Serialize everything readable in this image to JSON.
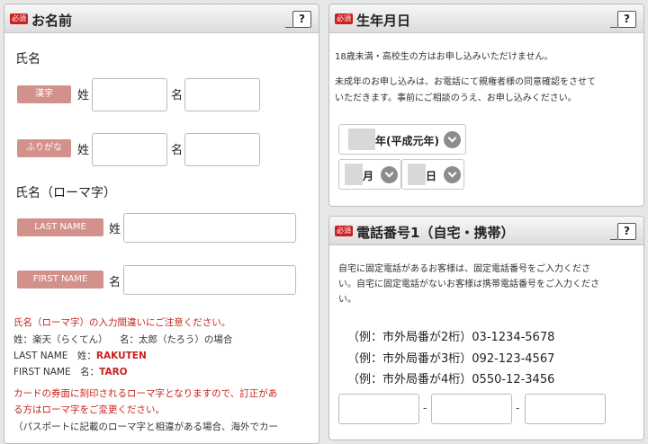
{
  "left_panel": {
    "required_badge": "必須",
    "title": "お名前",
    "help_label": "?",
    "name_heading": "氏名",
    "kanji_tag": "漢字",
    "furigana_tag": "ふりがな",
    "last_label": "姓",
    "first_label": "名",
    "romaji_heading": "氏名（ローマ字）",
    "last_name_tag": "LAST NAME",
    "first_name_tag": "FIRST NAME",
    "caution": "氏名（ローマ字）の入力間違いにご注意ください。",
    "example_line1_a": "姓：楽天（らくてん）",
    "example_line1_b": "名：太郎（たろう）の場合",
    "example_line2_label": "LAST NAME　姓：",
    "example_line2_value": "RAKUTEN",
    "example_line3_label": "FIRST NAME　名：",
    "example_line3_value": "TARO",
    "card_note_1": "カードの券面に刻印されるローマ字となりますので、訂正があ",
    "card_note_2": "る方はローマ字をご変更ください。",
    "passport_note": "（パスポートに記載のローマ字と相違がある場合、海外でカー"
  },
  "birth_panel": {
    "required_badge": "必須",
    "title": "生年月日",
    "help_label": "?",
    "notice_1": "18歳未満・高校生の方はお申し込みいただけません。",
    "notice_2a": "未成年のお申し込みは、お電話にて親権者様の同意確認をさせて",
    "notice_2b": "いただきます。事前にご相談のうえ、お申し込みください。",
    "year_label": "年(平成元年)",
    "month_label": "月",
    "day_label": "日"
  },
  "phone_panel": {
    "required_badge": "必須",
    "title": "電話番号1（自宅・携帯）",
    "help_label": "?",
    "desc_1": "自宅に固定電話があるお客様は、固定電話番号をご入力くださ",
    "desc_2": "い。自宅に固定電話がないお客様は携帯電話番号をご入力くださ",
    "desc_3": "い。",
    "examples": [
      "（例：市外局番が2桁）03-1234-5678",
      "（例：市外局番が3桁）092-123-4567",
      "（例：市外局番が4桁）0550-12-3456"
    ],
    "separator": "-"
  }
}
